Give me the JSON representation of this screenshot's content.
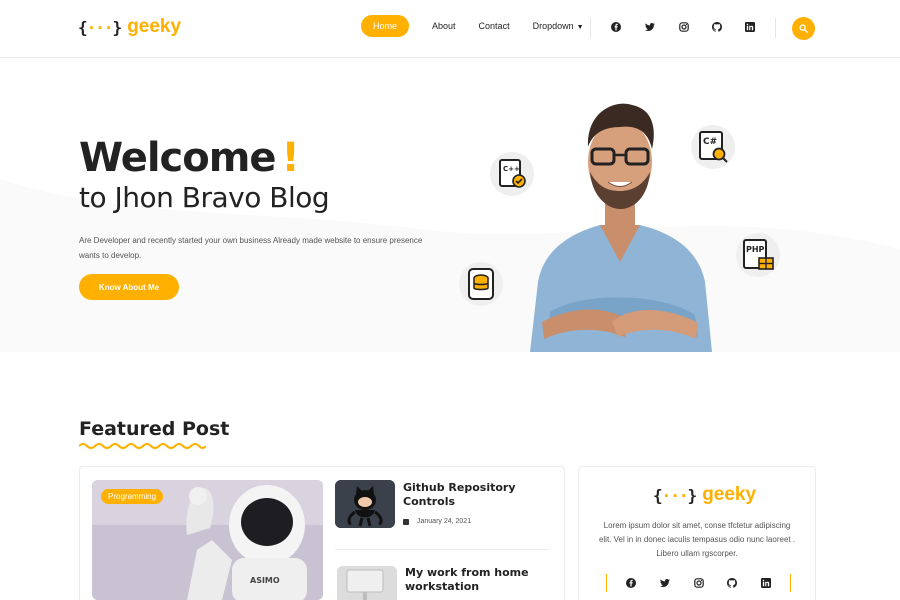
{
  "brand": {
    "name": "geeky",
    "mark": "{···}"
  },
  "nav": {
    "items": [
      {
        "label": "Home",
        "active": true
      },
      {
        "label": "About",
        "active": false
      },
      {
        "label": "Contact",
        "active": false
      },
      {
        "label": "Dropdown",
        "active": false
      }
    ],
    "social_icons": [
      "facebook-icon",
      "twitter-icon",
      "instagram-icon",
      "github-icon",
      "linkedin-icon"
    ],
    "search_icon": "search-icon"
  },
  "hero": {
    "title": "Welcome",
    "title_accent": "!",
    "subtitle": "to Jhon Bravo Blog",
    "description": "Are Developer and recently started your own business Already made website to ensure presence wants to develop.",
    "button_label": "Know About Me",
    "tech_icons": [
      "cpp-file-icon",
      "csharp-search-icon",
      "database-icon",
      "php-file-icon"
    ]
  },
  "featured": {
    "title": "Featured Post",
    "main_post": {
      "tag": "Programming"
    },
    "posts": [
      {
        "title": "Github Repository Controls",
        "date": "January 24, 2021"
      },
      {
        "title": "My work from home workstation",
        "date": ""
      }
    ]
  },
  "sidebar": {
    "brand": "geeky",
    "text": "Lorem ipsum dolor sit amet, conse tfctetur adipiscing elit. Vel in in donec iaculis tempasus odio nunc laoreet . Libero ullam rgscorper.",
    "social_icons": [
      "facebook-icon",
      "twitter-icon",
      "instagram-icon",
      "github-icon",
      "linkedin-icon"
    ]
  },
  "colors": {
    "accent": "#ffb000",
    "text": "#222222",
    "muted": "#555555"
  }
}
